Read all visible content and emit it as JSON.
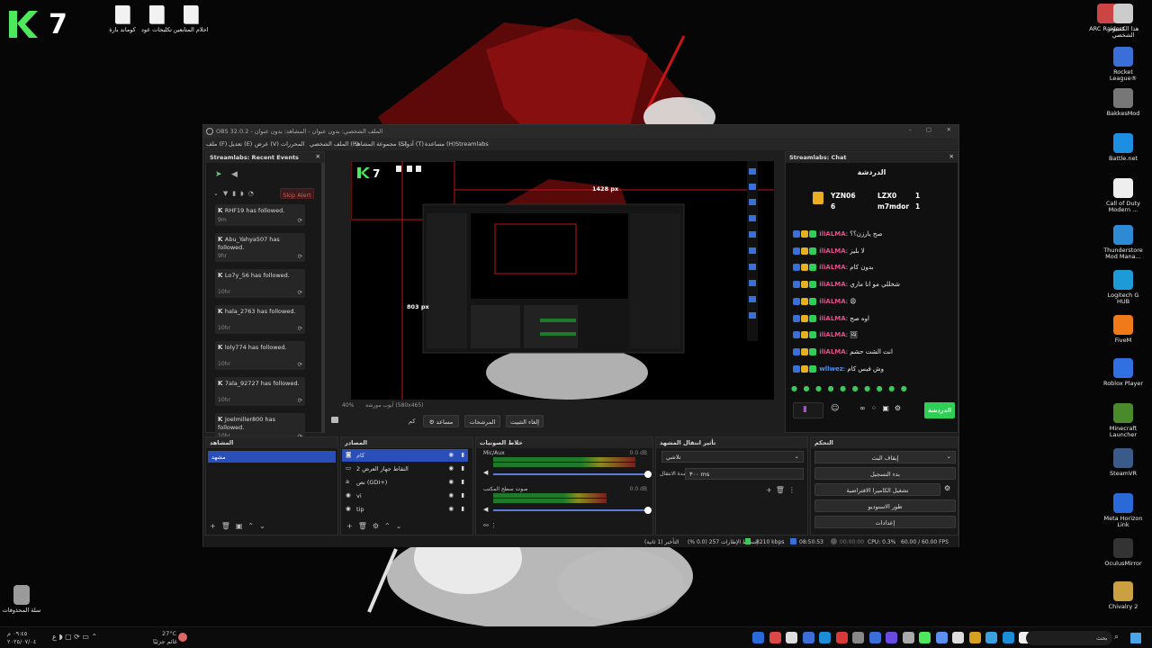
{
  "desktop": {
    "logo_number": "7",
    "left_icons": [
      "كوماند بارة",
      "تكليجات عود",
      "احلام المتابعين"
    ],
    "recycle_bin": "سلة المحذوفات",
    "right_icons": [
      {
        "label": "ARC Raiders",
        "color": "#c44"
      },
      {
        "label": "هذا الكمبيوتر الشخصي",
        "color": "#ccc"
      },
      {
        "label": "Rocket League®",
        "color": "#3a6fd8"
      },
      {
        "label": "BakkesMod",
        "color": "#777"
      },
      {
        "label": "Battle.net",
        "color": "#1e8fe0"
      },
      {
        "label": "Call of Duty Modern ...",
        "color": "#eee"
      },
      {
        "label": "Thunderstore Mod Mana...",
        "color": "#2d8bd6"
      },
      {
        "label": "Logitech G HUB",
        "color": "#1c9bd6"
      },
      {
        "label": "FiveM",
        "color": "#f07a1a"
      },
      {
        "label": "Roblox Player",
        "color": "#3170e0"
      },
      {
        "label": "Minecraft Launcher",
        "color": "#4a8a2a"
      },
      {
        "label": "SteamVR",
        "color": "#3a5a8a"
      },
      {
        "label": "Meta Horizon Link",
        "color": "#2a6ad8"
      },
      {
        "label": "OculusMirror",
        "color": "#333"
      },
      {
        "label": "Chivalry 2",
        "color": "#caa040"
      }
    ]
  },
  "taskbar": {
    "search": "بحث",
    "weather": "27°C",
    "weather_sub": "غائم جزئيًا",
    "time": "٠٩:٤٥ م",
    "date": "٢٠٢٥/٠٧/٠٤"
  },
  "obs": {
    "title": "OBS 32.0.2 - الملف الشخصي: بدون عنوان - المشاهد: بدون عنوان",
    "menu": [
      "ملف (F)",
      "تعديل (E)",
      "عرض (V)",
      "المحررات",
      "الملف الشخصي (P)",
      "مجموعة المشاهد (S)",
      "أدوات (T)",
      "مساعدة (H)",
      "Streamlabs"
    ],
    "events_panel": {
      "title": "Streamlabs: Recent Events",
      "skip_alert": "Skip Alert",
      "events": [
        {
          "name": "RHF19 has followed.",
          "time": "9m"
        },
        {
          "name": "Abu_Yahya507 has followed.",
          "time": "9hr"
        },
        {
          "name": "Lo7y_56 has followed.",
          "time": "10hr"
        },
        {
          "name": "hala_2763 has followed.",
          "time": "10hr"
        },
        {
          "name": "loly774 has followed.",
          "time": "10hr"
        },
        {
          "name": "7ala_92727 has followed.",
          "time": "10hr"
        },
        {
          "name": "Joelmiller800 has followed.",
          "time": "10hr"
        }
      ]
    },
    "preview": {
      "size_w": "1428 px",
      "size_h": "803 px",
      "scene_label": "آبوب مورشة (580x465)"
    },
    "preview_controls": [
      "كم",
      "مساعد",
      "المرشحات",
      "إلغاء التثبيت"
    ],
    "chat": {
      "title": "Streamlabs: Chat",
      "heading": "الدردشة",
      "leaders": [
        {
          "name": "YZN06",
          "value": "6"
        },
        {
          "name": "LZX0",
          "value": "1"
        },
        {
          "name": "m7mdor",
          "value": "1"
        }
      ],
      "lines": [
        {
          "user": "iliALMA",
          "msg": "صح يارزن؟؟"
        },
        {
          "user": "iliALMA",
          "msg": "لا بليز"
        },
        {
          "user": "iliALMA",
          "msg": "بدون كام"
        },
        {
          "user": "iliALMA",
          "msg": "شخللي مو انا ماري"
        },
        {
          "user": "iliALMA",
          "msg": "😩"
        },
        {
          "user": "iliALMA",
          "msg": "اوه صح"
        },
        {
          "user": "iliALMA",
          "msg": "🖼"
        },
        {
          "user": "iliALMA",
          "msg": "انت الشت حشم"
        },
        {
          "user": "wllwez",
          "msg": "وش فيس كام"
        }
      ],
      "send_button": "الدردشة"
    },
    "scenes": {
      "title": "المشاهد",
      "items": [
        "مشهد"
      ]
    },
    "sources": {
      "title": "المصادر",
      "items": [
        "كام",
        "التقاط جهاز العرض 2",
        "نص (GDI+)",
        "vi",
        "tip"
      ]
    },
    "mixer": {
      "title": "خلاط الصوتيات",
      "channels": [
        {
          "name": "Mic/Aux",
          "db": "0.0 dB",
          "level": 0.9
        },
        {
          "name": "صوت سطح المكتب",
          "db": "0.0 dB",
          "level": 0.72
        }
      ],
      "ticks": [
        "-60",
        "-55",
        "-50",
        "-45",
        "-40",
        "-35",
        "-30",
        "-25",
        "-20",
        "-15",
        "-10",
        "-5",
        "0"
      ]
    },
    "transitions": {
      "title": "تأثير انتقال المشهد",
      "type": "تلاشي",
      "duration_label": "مدة الانتقال",
      "duration": "٣٠٠ ms"
    },
    "controls": {
      "title": "التحكم",
      "buttons": [
        "إيقاف البث",
        "بدء التسجيل",
        "تشغيل الكاميرا الافتراضية",
        "طور الاستوديو",
        "إعدادات"
      ]
    },
    "status": {
      "dropped": "إسقاط الإطارات 257 (0.0 %)",
      "delay": "التأخير (1 ثانية)",
      "bitrate": "8210 kbps",
      "live_time": "08:50:53",
      "rec_time": "00:00:00",
      "cpu": "CPU: 0.3%",
      "fps": "60.00 / 60.00 FPS"
    }
  }
}
